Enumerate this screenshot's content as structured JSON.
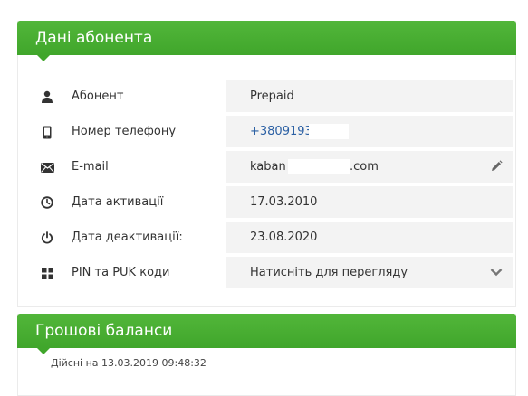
{
  "subscriber": {
    "title": "Дані абонента",
    "rows": [
      {
        "icon": "person-icon",
        "label": "Абонент",
        "value": "Prepaid"
      },
      {
        "icon": "phone-icon",
        "label": "Номер телефону",
        "value": "+3809193"
      },
      {
        "icon": "envelope-icon",
        "label": "E-mail",
        "value_prefix": "kaban",
        "value_suffix": ".com",
        "action_icon": "pencil-icon"
      },
      {
        "icon": "clock-icon",
        "label": "Дата активації",
        "value": "17.03.2010"
      },
      {
        "icon": "power-icon",
        "label": "Дата деактивації:",
        "value": "23.08.2020"
      },
      {
        "icon": "grid-icon",
        "label": "PIN та PUK коди",
        "value": "Натисніть для перегляду",
        "action_icon": "chevron-down-icon"
      }
    ]
  },
  "balance": {
    "title": "Грошові баланси",
    "valid_text": "Дійсні на 13.03.2019 09:48:32"
  },
  "colors": {
    "header_green": "#4caf35",
    "phone_link": "#2a5fa3",
    "value_bg": "#f3f3f3"
  }
}
